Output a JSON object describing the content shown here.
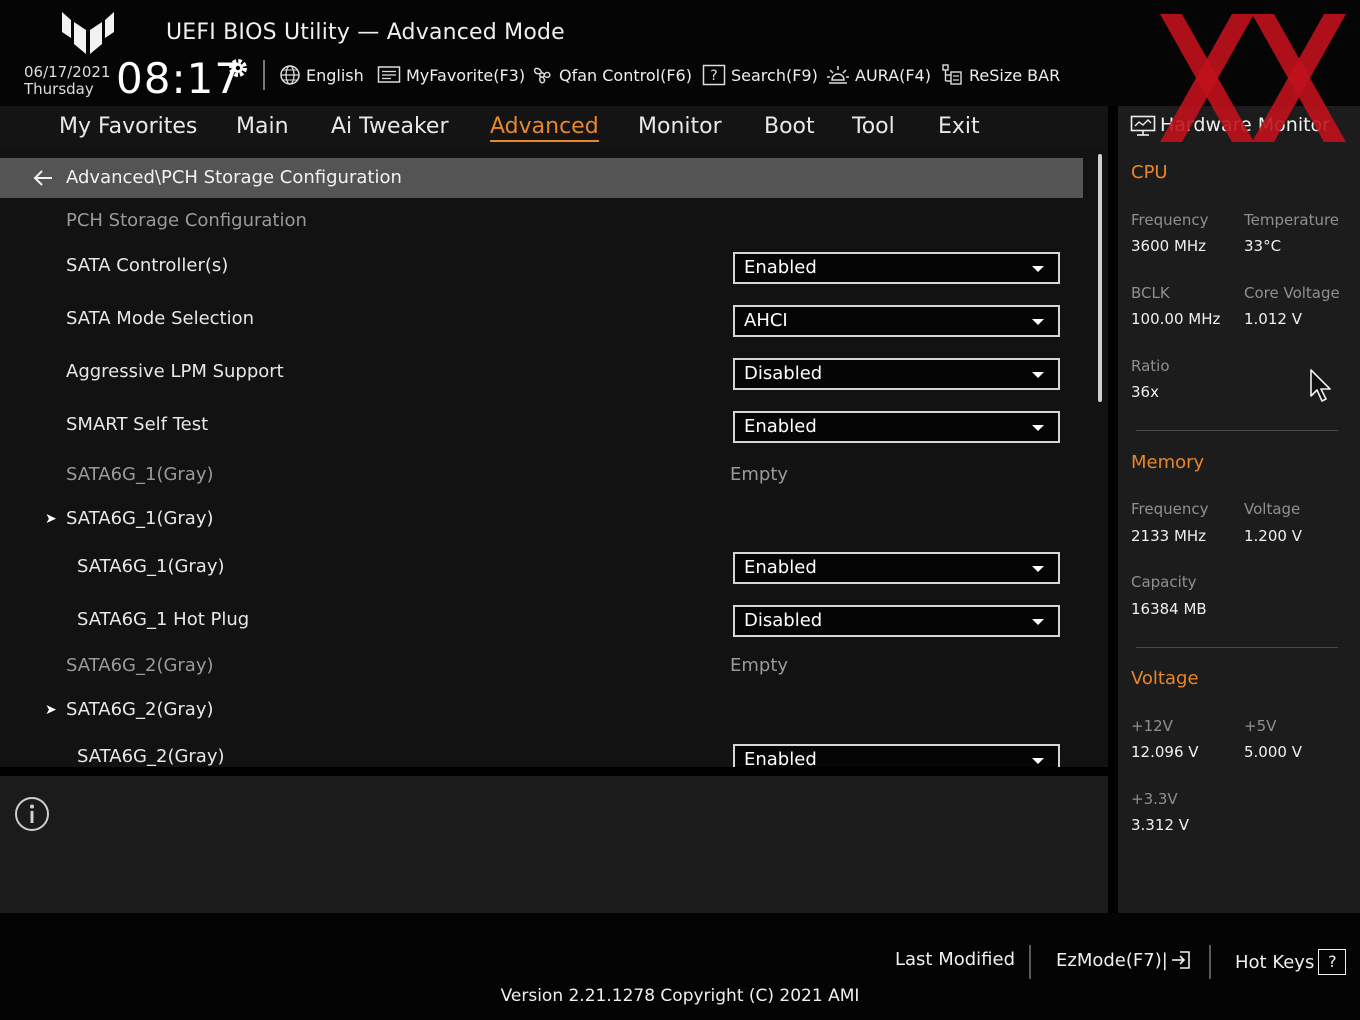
{
  "header": {
    "title": "UEFI BIOS Utility — Advanced Mode",
    "date": "06/17/2021",
    "day": "Thursday",
    "time": "08:17",
    "language": "English",
    "my_favorite": "MyFavorite(F3)",
    "qfan": "Qfan Control(F6)",
    "search": "Search(F9)",
    "aura": "AURA(F4)",
    "resize_bar": "ReSize BAR"
  },
  "nav": {
    "tabs": [
      {
        "label": "My Favorites"
      },
      {
        "label": "Main"
      },
      {
        "label": "Ai Tweaker"
      },
      {
        "label": "Advanced"
      },
      {
        "label": "Monitor"
      },
      {
        "label": "Boot"
      },
      {
        "label": "Tool"
      },
      {
        "label": "Exit"
      }
    ],
    "active": "Advanced"
  },
  "breadcrumb": "Advanced\\PCH Storage Configuration",
  "section_title": "PCH Storage Configuration",
  "rows": [
    {
      "label": "SATA Controller(s)",
      "value": "Enabled"
    },
    {
      "label": "SATA Mode Selection",
      "value": "AHCI"
    },
    {
      "label": "Aggressive LPM Support",
      "value": "Disabled"
    },
    {
      "label": "SMART Self Test",
      "value": "Enabled"
    },
    {
      "label": "SATA6G_1(Gray)",
      "value": "Empty"
    },
    {
      "label": "SATA6G_1(Gray)"
    },
    {
      "label": "SATA6G_1(Gray)",
      "value": "Enabled"
    },
    {
      "label": "SATA6G_1 Hot Plug",
      "value": "Disabled"
    },
    {
      "label": "SATA6G_2(Gray)",
      "value": "Empty"
    },
    {
      "label": "SATA6G_2(Gray)"
    },
    {
      "label": "SATA6G_2(Gray)",
      "value": "Enabled"
    }
  ],
  "hw_monitor": {
    "title": "Hardware Monitor",
    "cpu": {
      "heading": "CPU",
      "frequency_label": "Frequency",
      "frequency": "3600 MHz",
      "temperature_label": "Temperature",
      "temperature": "33°C",
      "bclk_label": "BCLK",
      "bclk": "100.00 MHz",
      "core_voltage_label": "Core Voltage",
      "core_voltage": "1.012 V",
      "ratio_label": "Ratio",
      "ratio": "36x"
    },
    "memory": {
      "heading": "Memory",
      "frequency_label": "Frequency",
      "frequency": "2133 MHz",
      "voltage_label": "Voltage",
      "voltage": "1.200 V",
      "capacity_label": "Capacity",
      "capacity": "16384 MB"
    },
    "voltage": {
      "heading": "Voltage",
      "v12_label": "+12V",
      "v12": "12.096 V",
      "v5_label": "+5V",
      "v5": "5.000 V",
      "v33_label": "+3.3V",
      "v33": "3.312 V"
    }
  },
  "footer": {
    "last_modified": "Last Modified",
    "ezmode": "EzMode(F7)|",
    "hot_keys": "Hot Keys",
    "hot_keys_glyph": "?",
    "version": "Version 2.21.1278 Copyright (C) 2021 AMI"
  },
  "colors": {
    "accent": "#e8862a",
    "watermark": "#c0121c"
  }
}
